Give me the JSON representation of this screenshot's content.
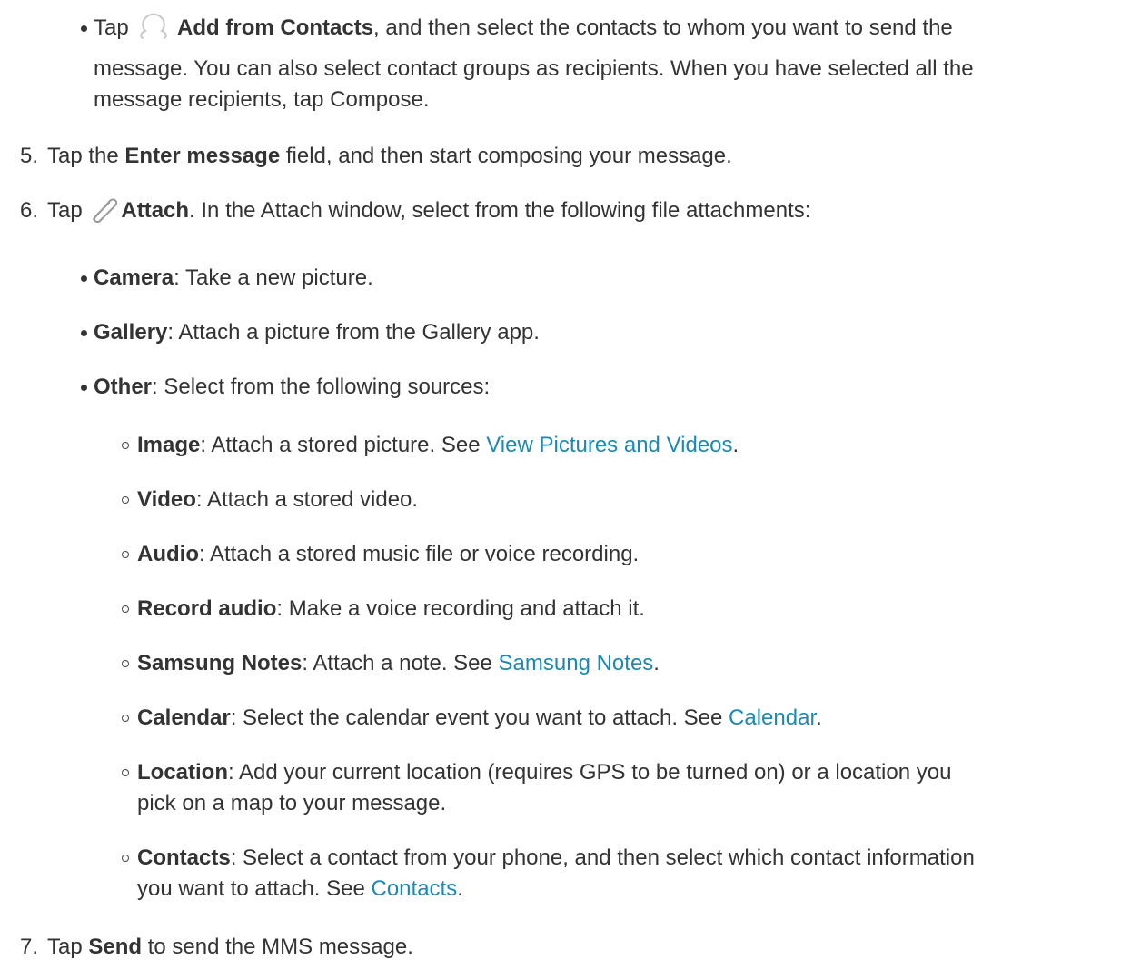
{
  "add_contacts_item": {
    "prefix": "Tap ",
    "bold": "Add from Contacts",
    "line1_rest": ", and then select the contacts to whom you want to send the",
    "line2": "message. You can also select contact groups as recipients. When you have selected all the",
    "line3": "message recipients, tap Compose."
  },
  "steps": [
    {
      "num": "5.",
      "prefix": "Tap the ",
      "bold": "Enter message",
      "rest": " field, and then start composing your message."
    },
    {
      "num": "6.",
      "prefix": "Tap ",
      "bold": "Attach",
      "rest": ". In the Attach window, select from the following file attachments:"
    },
    {
      "num": "7.",
      "prefix": "Tap ",
      "bold": "Send",
      "rest": " to send the MMS message."
    }
  ],
  "attach_options": [
    {
      "bold": "Camera",
      "rest": ": Take a new picture."
    },
    {
      "bold": "Gallery",
      "rest": ": Attach a picture from the Gallery app."
    },
    {
      "bold": "Other",
      "rest": ": Select from the following sources:"
    }
  ],
  "other_sources": [
    {
      "bold": "Image",
      "rest": ": Attach a stored picture. See ",
      "link": "View Pictures and Videos",
      "after": "."
    },
    {
      "bold": "Video",
      "rest": ": Attach a stored video."
    },
    {
      "bold": "Audio",
      "rest": ": Attach a stored music file or voice recording."
    },
    {
      "bold": "Record audio",
      "rest": ": Make a voice recording and attach it."
    },
    {
      "bold": "Samsung Notes",
      "rest": ": Attach a note. See ",
      "link": "Samsung Notes",
      "after": "."
    },
    {
      "bold": "Calendar",
      "rest": ": Select the calendar event you want to attach. See ",
      "link": "Calendar",
      "after": "."
    },
    {
      "bold": "Location",
      "rest": ": Add your current location (requires GPS to be turned on) or a location you",
      "line2": "pick on a map to your message."
    },
    {
      "bold": "Contacts",
      "rest": ": Select a contact from your phone, and then select which contact information",
      "line2_prefix": "you want to attach. See ",
      "link": "Contacts",
      "after": "."
    }
  ],
  "icons": {
    "contacts": "person-icon",
    "attach": "paperclip-icon"
  },
  "colors": {
    "text": "#333333",
    "link": "#1a8ab5"
  }
}
